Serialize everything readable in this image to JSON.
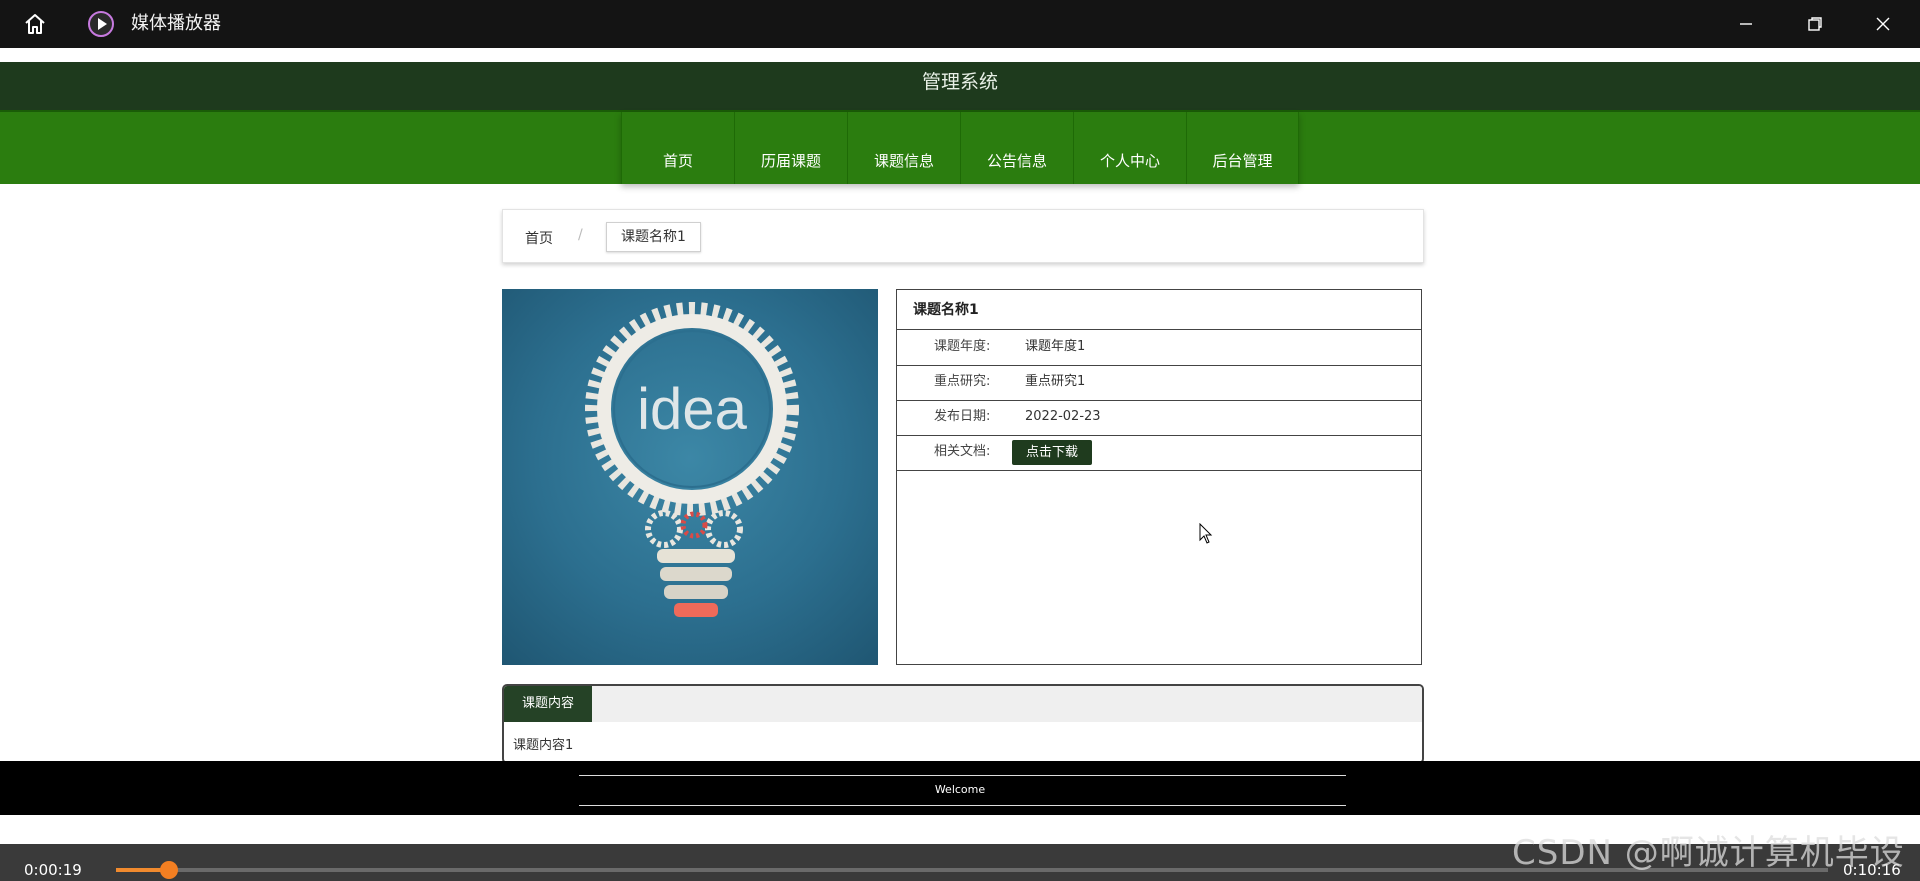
{
  "window": {
    "title": "媒体播放器",
    "icons": {
      "home": "home-icon",
      "app": "play-circle-icon",
      "minimize": "minimize-icon",
      "maximize": "restore-icon",
      "close": "close-icon"
    }
  },
  "site": {
    "header_title": "管理系统",
    "nav": [
      "首页",
      "历届课题",
      "课题信息",
      "公告信息",
      "个人中心",
      "后台管理"
    ],
    "colors": {
      "header": "#1e3a1d",
      "nav": "#2b7d0f",
      "accent_dark": "#254226"
    }
  },
  "breadcrumb": {
    "home": "首页",
    "separator": "/",
    "current": "课题名称1"
  },
  "topic": {
    "image_word": "idea",
    "title": "课题名称1",
    "fields": [
      {
        "label": "课题年度:",
        "value": "课题年度1"
      },
      {
        "label": "重点研究:",
        "value": "重点研究1"
      },
      {
        "label": "发布日期:",
        "value": "2022-02-23"
      },
      {
        "label": "相关文档:",
        "button": "点击下载"
      }
    ]
  },
  "content": {
    "tab_label": "课题内容",
    "text": "课题内容1"
  },
  "footer": {
    "text": "Welcome"
  },
  "player": {
    "elapsed": "0:00:19",
    "total": "0:10:16",
    "progress": 0.031
  },
  "watermark": "CSDN @啊诚计算机毕设"
}
